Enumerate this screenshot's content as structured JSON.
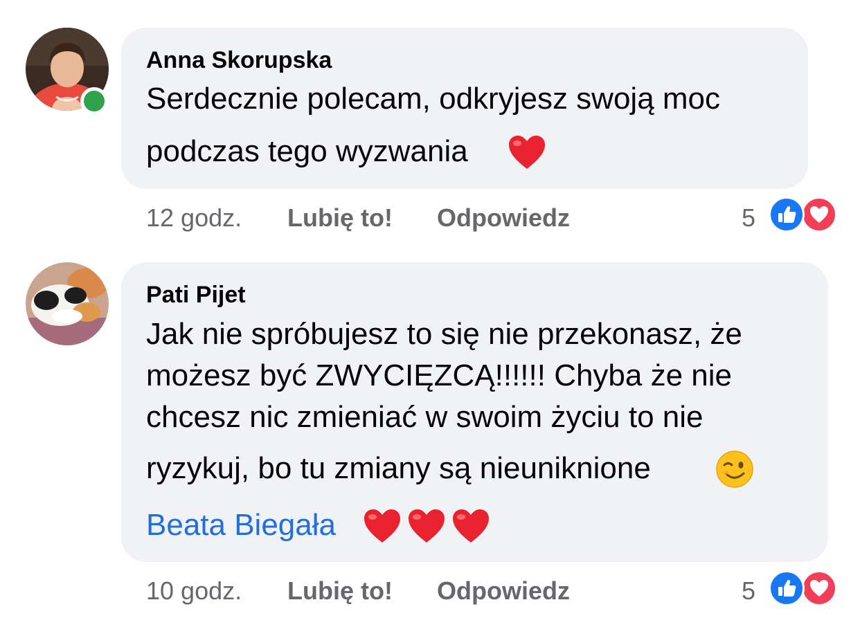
{
  "comments": [
    {
      "author": "Anna Skorupska",
      "lines": [
        "Serdecznie polecam, odkryjesz swoją moc",
        "podczas tego wyzwania"
      ],
      "emojis": [
        "red-heart"
      ],
      "online": true,
      "time": "12 godz.",
      "like_label": "Lubię to!",
      "reply_label": "Odpowiedz",
      "reactions_count": "5",
      "reaction_icons": [
        "like-icon",
        "love-icon"
      ]
    },
    {
      "author": "Pati Pijet",
      "lines": [
        "Jak nie spróbujesz to się nie przekonasz, że",
        "możesz być ZWYCIĘZCĄ!!!!!! Chyba że nie",
        "chcesz nic zmieniać w swoim życiu to nie",
        "ryzykuj, bo tu zmiany są nieuniknione"
      ],
      "mention": "Beata Biegała",
      "emojis": [
        "winking-face",
        "red-heart",
        "red-heart",
        "red-heart"
      ],
      "online": false,
      "time": "10 godz.",
      "like_label": "Lubię to!",
      "reply_label": "Odpowiedz",
      "reactions_count": "5",
      "reaction_icons": [
        "like-icon",
        "love-icon"
      ]
    }
  ],
  "colors": {
    "bubble": "#f0f2f5",
    "text": "#050505",
    "meta": "#65676b",
    "mention": "#216fdb",
    "like": "#1877f2",
    "love": "#f33e58",
    "online": "#31a24c"
  }
}
